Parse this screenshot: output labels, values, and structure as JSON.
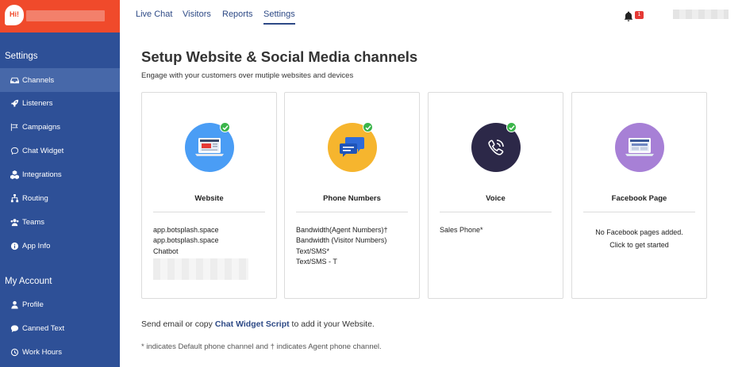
{
  "brand": {
    "logo_text": "Hi!"
  },
  "sidebar": {
    "settings_heading": "Settings",
    "settings_items": [
      {
        "label": "Channels",
        "icon": "inbox-icon",
        "active": true
      },
      {
        "label": "Listeners",
        "icon": "rocket-icon"
      },
      {
        "label": "Campaigns",
        "icon": "flag-icon"
      },
      {
        "label": "Chat Widget",
        "icon": "chat-bubble-icon"
      },
      {
        "label": "Integrations",
        "icon": "cubes-icon"
      },
      {
        "label": "Routing",
        "icon": "sitemap-icon"
      },
      {
        "label": "Teams",
        "icon": "users-icon"
      },
      {
        "label": "App Info",
        "icon": "info-icon"
      }
    ],
    "account_heading": "My Account",
    "account_items": [
      {
        "label": "Profile",
        "icon": "user-icon"
      },
      {
        "label": "Canned Text",
        "icon": "comment-icon"
      },
      {
        "label": "Work Hours",
        "icon": "clock-icon"
      }
    ]
  },
  "topbar": {
    "tabs": [
      "Live Chat",
      "Visitors",
      "Reports",
      "Settings"
    ],
    "active_tab": "Settings",
    "notification_count": "1"
  },
  "main": {
    "title": "Setup Website & Social Media channels",
    "subtitle": "Engage with your customers over mutiple websites and devices",
    "cards": [
      {
        "title": "Website",
        "icon": "laptop-browser-icon",
        "color": "#4a9df5",
        "checked": true,
        "lines": [
          "app.botsplash.space",
          "app.botsplash.space",
          "Chatbot"
        ]
      },
      {
        "title": "Phone Numbers",
        "icon": "chat-bubbles-icon",
        "color": "#f6b52e",
        "checked": true,
        "lines": [
          "Bandwidth(Agent Numbers)†",
          "Bandwidth (Visitor Numbers)",
          "Text/SMS*",
          "Text/SMS - T"
        ]
      },
      {
        "title": "Voice",
        "icon": "phone-call-icon",
        "color": "#2c2848",
        "checked": true,
        "lines": [
          "Sales Phone*"
        ]
      },
      {
        "title": "Facebook Page",
        "icon": "laptop-facebook-icon",
        "color": "#a780d6",
        "checked": false,
        "lines": [
          "No Facebook pages added.",
          "Click to get started"
        ]
      }
    ],
    "footer_prefix": "Send email or copy ",
    "footer_link": "Chat Widget Script",
    "footer_suffix": " to add it your Website.",
    "footnote": "* indicates Default phone channel and † indicates Agent phone channel."
  }
}
